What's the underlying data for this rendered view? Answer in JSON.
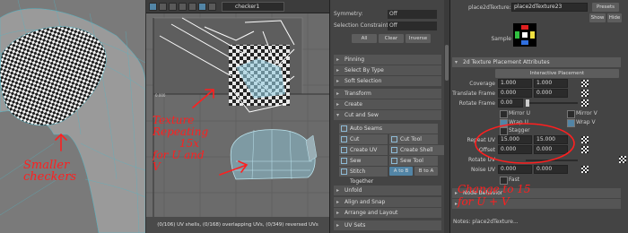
{
  "uv_editor": {
    "texture_select": "checker1",
    "status": "(0/106) UV shells, (0/168) overlapping UVs, (0/349) reversed UVs"
  },
  "toolkit": {
    "symmetry_label": "Symmetry:",
    "symmetry_value": "Off",
    "constraint_label": "Selection Constraint:",
    "constraint_value": "Off",
    "all_label": "All",
    "clear_label": "Clear",
    "inverse_label": "Inverse",
    "sections": {
      "pinning": "Pinning",
      "select_by_type": "Select By Type",
      "soft_selection": "Soft Selection",
      "transform": "Transform",
      "create": "Create",
      "cut_and_sew": "Cut and Sew",
      "unfold": "Unfold",
      "align_snap": "Align and Snap",
      "arrange_layout": "Arrange and Layout",
      "uv_sets": "UV Sets"
    },
    "auto_seams": "Auto Seams",
    "cut": "Cut",
    "cut_tool": "Cut Tool",
    "create_uv_shell": "Create UV Shell",
    "create_shell_grid": "Create Shell (Grid)",
    "sew": "Sew",
    "sew_tool": "Sew Tool",
    "stitch_together": "Stitch Together",
    "a_to_b": "A to B",
    "b_to_a": "B to A"
  },
  "attribute_editor": {
    "node_label": "place2dTexture:",
    "node_name": "place2dTexture23",
    "presets": "Presets",
    "show": "Show",
    "hide": "Hide",
    "sample_label": "Sample",
    "section_title": "2d Texture Placement Attributes",
    "interactive_placement": "Interactive Placement",
    "coverage_label": "Coverage",
    "coverage": [
      "1.000",
      "1.000"
    ],
    "translate_frame_label": "Translate Frame",
    "translate_frame": [
      "0.000",
      "0.000"
    ],
    "rotate_frame_label": "Rotate Frame",
    "rotate_frame": "0.00",
    "mirror_u": "Mirror U",
    "mirror_v": "Mirror V",
    "wrap_u": "Wrap U",
    "wrap_v": "Wrap V",
    "stagger": "Stagger",
    "repeat_uv_label": "Repeat UV",
    "repeat_uv": [
      "15.000",
      "15.000"
    ],
    "offset_label": "Offset",
    "offset": [
      "0.000",
      "0.000"
    ],
    "rotate_uv_label": "Rotate UV",
    "noise_uv_label": "Noise UV",
    "noise_uv": [
      "0.000",
      "0.000"
    ],
    "fast": "Fast",
    "node_behavior": "Node Behavior",
    "notes": "Notes: place2dTexture..."
  },
  "annotations": {
    "left": [
      "Smaller",
      "checkers"
    ],
    "middle": [
      "Texture",
      "Repeating",
      "15x",
      "for U and",
      "V"
    ],
    "right": [
      "Change to 15",
      "for U + V"
    ]
  },
  "colors": {
    "accent": "#5285a6",
    "annotation": "#ff1f1f",
    "panel": "#444444"
  }
}
